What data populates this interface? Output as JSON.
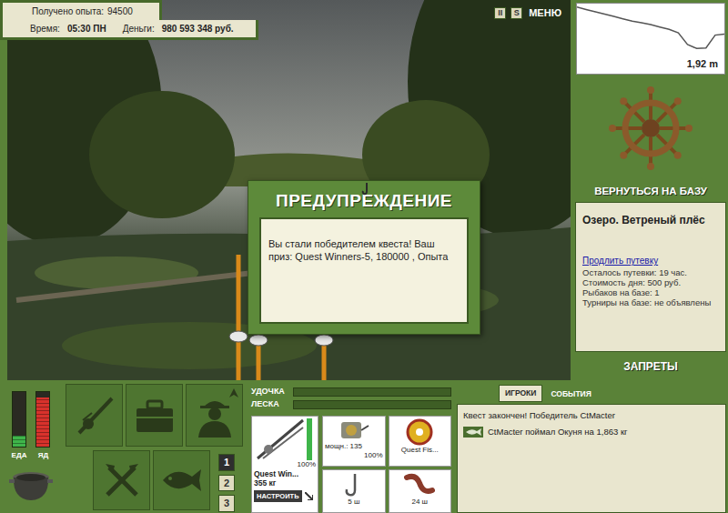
{
  "stats": {
    "experience_label": "Получено опыта:",
    "experience": "94500",
    "time_label": "Время:",
    "time": "05:30 ПН",
    "money_label": "Деньги:",
    "money": "980 593 348 руб."
  },
  "top_controls": [
    {
      "label": "II",
      "kind": "box"
    },
    {
      "label": "S",
      "kind": "box"
    },
    {
      "label": "МЕНЮ",
      "kind": "text"
    }
  ],
  "depth": {
    "reading": "1,92 m",
    "profile": [
      0.15,
      0.25,
      0.35,
      0.45,
      0.55,
      0.65,
      0.75,
      0.82,
      0.9,
      1.0,
      1.1,
      1.25,
      1.75,
      1.92,
      1.9,
      1.35,
      1.3
    ]
  },
  "base_button": "ВЕРНУТЬСЯ НА БАЗУ",
  "location": {
    "name": "Озеро. Ветреный плёс",
    "link": "Продлить путевку",
    "lines": [
      "Осталось путевки: 19 час.",
      "Стоимость дня: 500 руб.",
      "Рыбаков на базе: 1",
      "Турниры на базе: не объявлены"
    ]
  },
  "bans_button": "ЗАПРЕТЫ",
  "dialog": {
    "title": "ПРЕДУПРЕЖДЕНИЕ",
    "message": "Вы стали победителем квеста! Ваш приз: Quest Winners-5, 180000 , Опыта"
  },
  "meters": [
    {
      "label": "ЕДА",
      "level": 0.2,
      "color": "#3fb54a"
    },
    {
      "label": "ЯД",
      "level": 0.9,
      "color": "#d8322c"
    }
  ],
  "slots": [
    {
      "label": "1",
      "selected": true
    },
    {
      "label": "2",
      "selected": false
    },
    {
      "label": "3",
      "selected": false
    }
  ],
  "tension": [
    {
      "label": "УДОЧКА",
      "level": 0
    },
    {
      "label": "ЛЕСКА",
      "level": 0
    }
  ],
  "gear": {
    "rod": {
      "name": "Quest Win...",
      "weight": "355 кг",
      "condition": "100%",
      "level": 1
    },
    "setup_button": "НАСТРОИТЬ",
    "reel": {
      "power": "мощн.: 135",
      "condition": "100%"
    },
    "line": {
      "name": "Quest Fis..."
    },
    "hook": {
      "count": "5 ш"
    },
    "bait": {
      "count": "24 ш"
    }
  },
  "chat": {
    "tabs": [
      {
        "label": "ИГРОКИ",
        "selected": true
      },
      {
        "label": "СОБЫТИЯ",
        "selected": false
      }
    ],
    "messages": [
      {
        "text": "Квест закончен! Победитель CtMacter",
        "kind": "system"
      },
      {
        "text": "CtMacter поймал Окуня на 1,863 кг",
        "kind": "catch"
      }
    ]
  }
}
